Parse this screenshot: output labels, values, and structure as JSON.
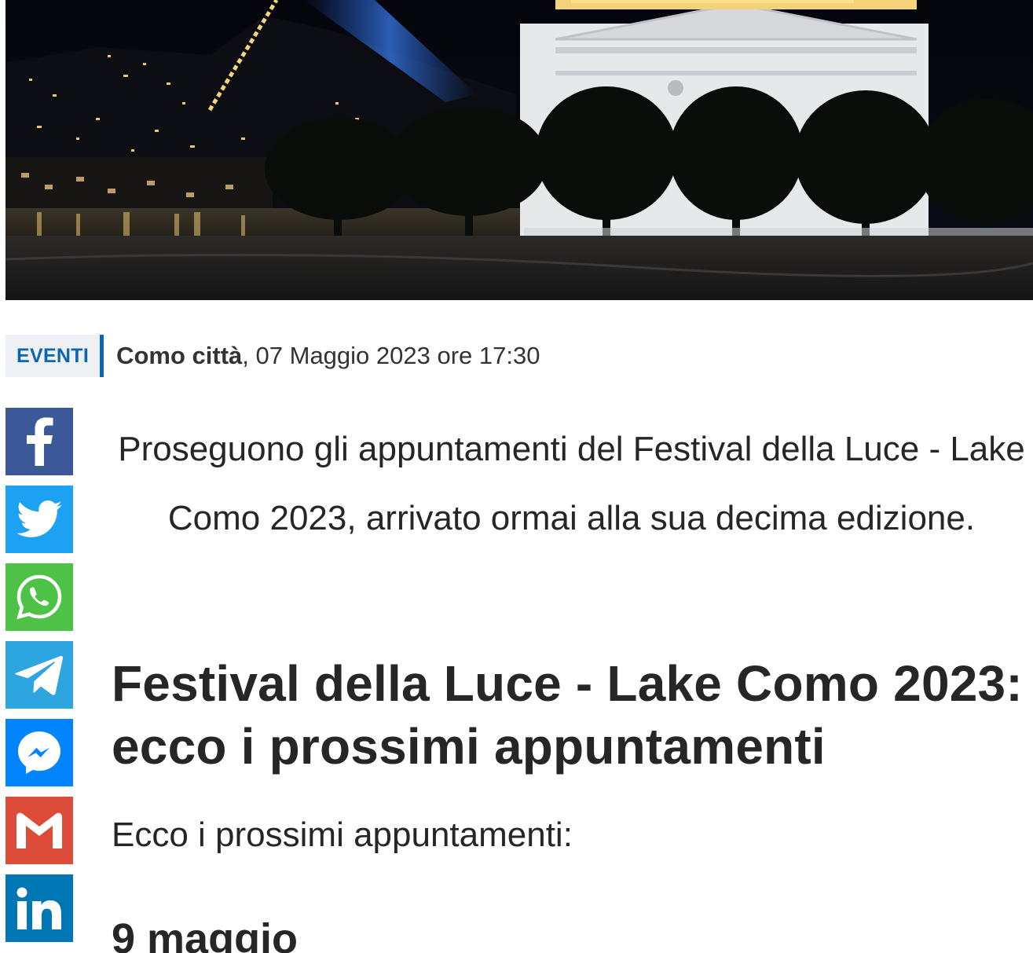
{
  "article": {
    "category": "EVENTI",
    "location": "Como città",
    "datetime": ", 07 Maggio 2023 ore 17:30",
    "lead": "Proseguono gli appuntamenti del Festival della Luce - Lake Como 2023, arrivato ormai alla sua decima edizione.",
    "headline": "Festival della Luce - Lake Como 2023: ecco i prossimi appuntamenti",
    "intro": "Ecco i prossimi appuntamenti:",
    "date_heading": "9 maggio"
  },
  "share": [
    {
      "network": "Facebook",
      "icon": "facebook-icon",
      "color": "#3b5998"
    },
    {
      "network": "Twitter",
      "icon": "twitter-icon",
      "color": "#1da1f2"
    },
    {
      "network": "WhatsApp",
      "icon": "whatsapp-icon",
      "color": "#4dc247"
    },
    {
      "network": "Telegram",
      "icon": "telegram-icon",
      "color": "#2ca5e0"
    },
    {
      "network": "Messenger",
      "icon": "messenger-icon",
      "color": "#0084ff"
    },
    {
      "network": "Gmail",
      "icon": "gmail-icon",
      "color": "#dd4b39"
    },
    {
      "network": "LinkedIn",
      "icon": "linkedin-icon",
      "color": "#0077b5"
    }
  ],
  "colors": {
    "accent": "#0d66b0",
    "text": "#262626"
  }
}
